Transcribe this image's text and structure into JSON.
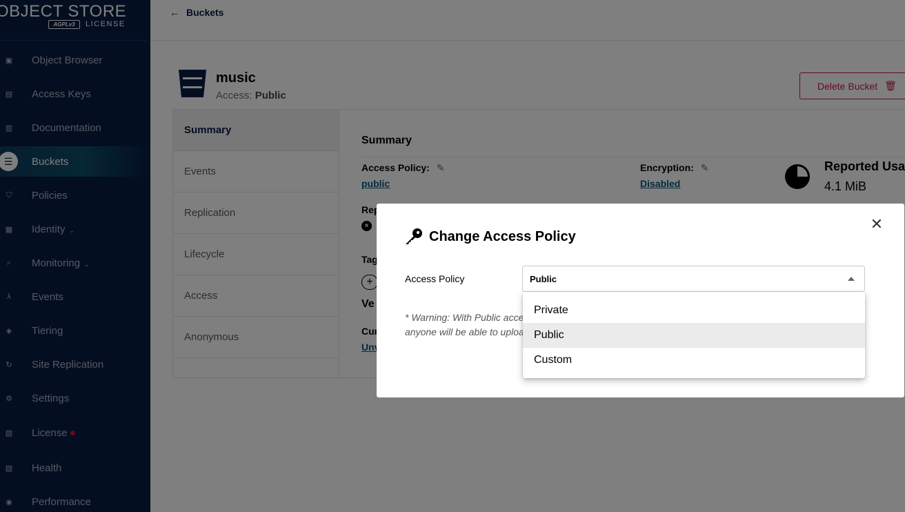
{
  "brand": {
    "title": "OBJECT STORE",
    "badge": "AGPLv3",
    "license": "LICENSE"
  },
  "sidebar": {
    "items": [
      {
        "label": "Object Browser",
        "icon": "object-browser-icon"
      },
      {
        "label": "Access Keys",
        "icon": "access-keys-icon"
      },
      {
        "label": "Documentation",
        "icon": "documentation-icon"
      },
      {
        "label": "Buckets",
        "icon": "bucket-icon",
        "active": true
      },
      {
        "label": "Policies",
        "icon": "policies-icon"
      },
      {
        "label": "Identity",
        "icon": "identity-icon",
        "expandable": true
      },
      {
        "label": "Monitoring",
        "icon": "monitoring-icon",
        "expandable": true
      },
      {
        "label": "Events",
        "icon": "lambda-icon"
      },
      {
        "label": "Tiering",
        "icon": "tiering-icon"
      },
      {
        "label": "Site Replication",
        "icon": "site-replication-icon"
      },
      {
        "label": "Settings",
        "icon": "gear-icon"
      },
      {
        "label": "License",
        "icon": "license-icon",
        "dot": true
      },
      {
        "label": "Health",
        "icon": "health-icon"
      },
      {
        "label": "Performance",
        "icon": "performance-icon"
      }
    ]
  },
  "topbar": {
    "back_label": "Buckets"
  },
  "bucket": {
    "name": "music",
    "access_label": "Access:",
    "access_value": "Public",
    "delete_label": "Delete Bucket"
  },
  "tabs": [
    "Summary",
    "Events",
    "Replication",
    "Lifecycle",
    "Access",
    "Anonymous"
  ],
  "summary": {
    "title": "Summary",
    "access_policy_label": "Access Policy:",
    "access_policy_value": "public",
    "encryption_label": "Encryption:",
    "encryption_value": "Disabled",
    "usage_title": "Reported Usage",
    "usage_value": "4.1 MiB",
    "rep_partial": "Rep",
    "tag_partial": "Tag",
    "ver_partial": "Ve",
    "cur_partial": "Cur",
    "unv_partial": "Unv"
  },
  "modal": {
    "title": "Change Access Policy",
    "field_label": "Access Policy",
    "selected_value": "Public",
    "warning": "* Warning: With Public access anyone will be able to upload, download and delete files from this Bucket *",
    "options": [
      "Private",
      "Public",
      "Custom"
    ],
    "selected_index": 1
  },
  "colors": {
    "sidebar_bg": "#081c42",
    "link": "#07587d",
    "danger": "#c51b3e"
  }
}
